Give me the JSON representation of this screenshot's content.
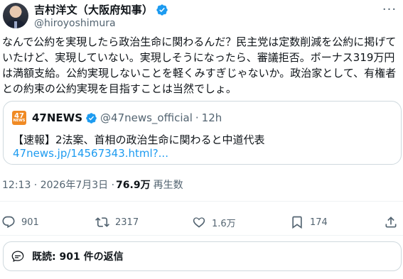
{
  "author": {
    "name": "吉村洋文（大阪府知事）",
    "handle": "@hiroyoshimura"
  },
  "more_label": "···",
  "tweet_text": "なんで公約を実現したら政治生命に関わるんだ？民主党は定数削減を公約に掲げていたけど、実現していない。実現しそうになったら、審議拒否。ボーナス319万円は満額支給。公約実現しないことを軽くみすぎじゃないか。政治家として、有権者との約束の公約実現を目指すことは当然でしょ。",
  "quoted": {
    "logo_number": "47",
    "logo_sub": "NEWS",
    "name": "47NEWS",
    "handle": "@47news_official",
    "separator": "·",
    "time": "12h",
    "text": "【速報】2法案、首相の政治生命に関わると中道代表",
    "link": "47news.jp/14567343.html?..."
  },
  "meta": {
    "timestamp": "12:13 · 2026年7月3日 ·",
    "views": "76.9万",
    "views_label": "再生数"
  },
  "actions": {
    "reply_count": "901",
    "retweet_count": "2317",
    "like_count": "1.6万",
    "bookmark_count": "174"
  },
  "replies_label": "既読: 901 件の返信",
  "colors": {
    "accent": "#1d9bf0",
    "verified": "#1d9bf0",
    "muted": "#536471",
    "border": "#cfd9de"
  }
}
